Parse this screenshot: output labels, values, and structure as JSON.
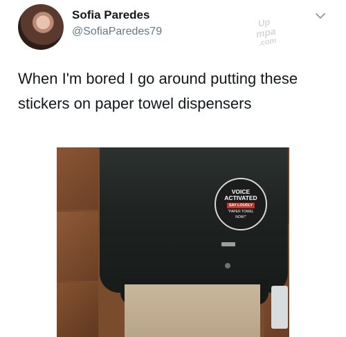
{
  "tweet": {
    "display_name": "Sofia Paredes",
    "handle": "@SofiaParedes79",
    "text": "When I'm bored I go around putting these stickers on paper towel dispensers"
  },
  "watermark": {
    "line1": "Up",
    "line2": "mpa",
    "line3": ".com"
  },
  "photo": {
    "sticker": {
      "line1": "VOICE",
      "line2": "ACTIVATED",
      "say_loudly": "SAY LOUDLY",
      "quote_line1": "\"PAPER TOWEL",
      "quote_line2": "NOW!\""
    }
  },
  "icons": {
    "menu": "chevron-down-icon"
  }
}
